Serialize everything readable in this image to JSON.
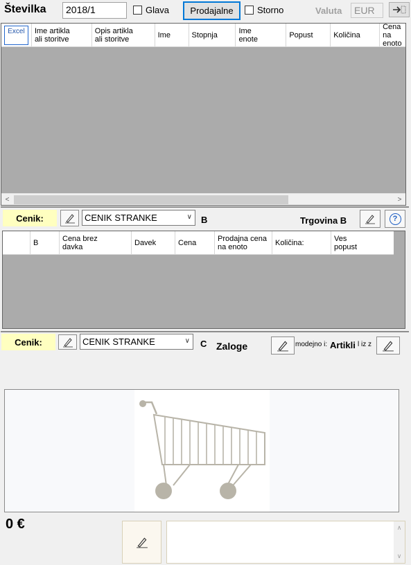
{
  "header": {
    "stevilka_label": "Številka",
    "stevilka_value": "2018/1",
    "glava_label": "Glava",
    "prodajalne_button": "Prodajalne",
    "storno_label": "Storno",
    "valuta_label": "Valuta",
    "valuta_value": "EUR"
  },
  "main_grid": {
    "corner_label": "Excel",
    "columns": [
      "Ime artikla\nali storitve",
      "Opis artikla\nali storitve",
      "Ime",
      "Stopnja",
      "Ime\nenote",
      "Popust",
      "Količina",
      "Cena na\nenoto"
    ]
  },
  "section_b": {
    "cenik_label": "Cenik:",
    "cenik_value": "CENIK STRANKE",
    "letter": "B",
    "trgovina_label": "Trgovina B",
    "help_glyph": "?",
    "columns": [
      "",
      "B",
      "Cena brez\ndavka",
      "Davek",
      "Cena",
      "Prodajna cena\nna enoto",
      "Količina:",
      "Ves\npopust"
    ]
  },
  "section_c": {
    "cenik_label": "Cenik:",
    "cenik_value": "CENIK STRANKE",
    "letter": "C",
    "zaloge_label": "Zaloge",
    "modejno_text": "modejno i:",
    "artikli_label": "Artikli",
    "iz_text": "l iz z"
  },
  "footer": {
    "total": "0 €"
  },
  "icons": {
    "pencil": "pencil-icon",
    "cart": "shopping-cart-icon",
    "exit": "exit-arrow-icon",
    "help": "help-icon"
  },
  "colors": {
    "grid_bg": "#ababab",
    "highlight_yellow": "#ffffc0",
    "focus_blue": "#0078d7"
  }
}
